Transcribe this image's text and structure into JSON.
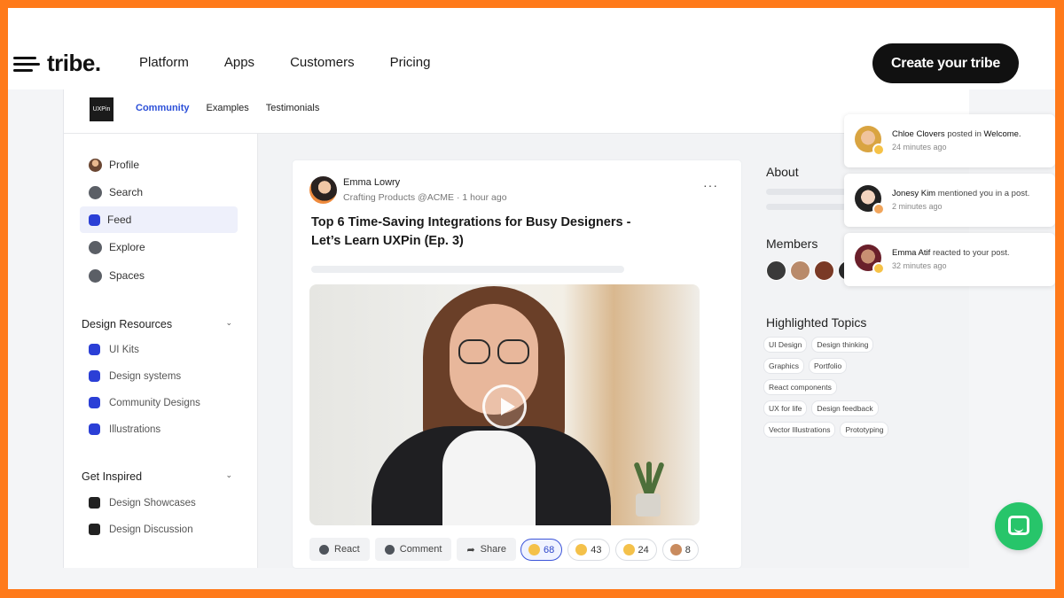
{
  "nav": {
    "logo": "tribe.",
    "links": [
      "Platform",
      "Apps",
      "Customers",
      "Pricing"
    ],
    "cta": "Create your tribe"
  },
  "app": {
    "brand": "UXPin",
    "tabs": [
      "Community",
      "Examples",
      "Testimonials"
    ],
    "active_tab": "Community"
  },
  "sidebar": {
    "items": [
      {
        "label": "Profile",
        "icon": "user-avatar-icon"
      },
      {
        "label": "Search",
        "icon": "search-icon"
      },
      {
        "label": "Feed",
        "icon": "feed-icon",
        "active": true
      },
      {
        "label": "Explore",
        "icon": "compass-icon"
      },
      {
        "label": "Spaces",
        "icon": "grid-icon"
      }
    ],
    "groups": [
      {
        "title": "Design Resources",
        "items": [
          "UI Kits",
          "Design systems",
          "Community Designs",
          "Illustrations"
        ]
      },
      {
        "title": "Get Inspired",
        "items": [
          "Design Showcases",
          "Design Discussion"
        ]
      }
    ]
  },
  "post": {
    "author": "Emma Lowry",
    "role": "Crafting Products @ACME",
    "time": "· 1 hour ago",
    "more": "···",
    "title": "Top 6 Time-Saving Integrations for Busy Designers - Let’s Learn UXPin (Ep. 3)",
    "actions": [
      "React",
      "Comment",
      "Share"
    ],
    "reactions": [
      {
        "count": "68",
        "active": true
      },
      {
        "count": "43"
      },
      {
        "count": "24"
      },
      {
        "count": "8"
      }
    ]
  },
  "right": {
    "about_title": "About",
    "members_title": "Members",
    "topics_title": "Highlighted Topics",
    "topic_rows": [
      [
        "UI Design",
        "Design thinking"
      ],
      [
        "Graphics",
        "Portfolio"
      ],
      [
        "React components"
      ],
      [
        "UX for life",
        "Design feedback"
      ],
      [
        "Vector Illustrations",
        "Prototyping"
      ]
    ]
  },
  "notifications": [
    {
      "name": "Chloe Clovers",
      "action": "posted in",
      "target": "Welcome.",
      "time": "24 minutes ago"
    },
    {
      "name": "Jonesy Kim",
      "action": "mentioned you in a post.",
      "target": "",
      "time": "2 minutes ago"
    },
    {
      "name": "Emma Atif",
      "action": "reacted to your post.",
      "target": "",
      "time": "32 minutes ago"
    }
  ],
  "colors": {
    "accent": "#2b4fd8",
    "frame": "#ff7a1a",
    "chat": "#27c56a"
  }
}
